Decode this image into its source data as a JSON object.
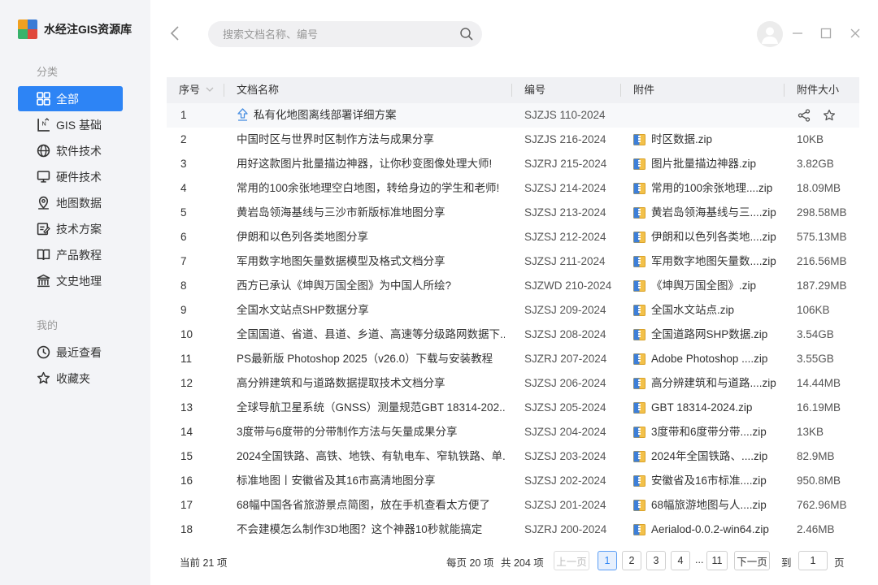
{
  "app": {
    "title": "水经注GIS资源库"
  },
  "sidebar": {
    "section_category": "分类",
    "categories": [
      {
        "label": "全部",
        "icon": "grid-icon",
        "active": true
      },
      {
        "label": "GIS 基础",
        "icon": "gis-basic-icon"
      },
      {
        "label": "软件技术",
        "icon": "globe-icon"
      },
      {
        "label": "硬件技术",
        "icon": "monitor-icon"
      },
      {
        "label": "地图数据",
        "icon": "map-pin-icon"
      },
      {
        "label": "技术方案",
        "icon": "edit-doc-icon"
      },
      {
        "label": "产品教程",
        "icon": "book-icon"
      },
      {
        "label": "文史地理",
        "icon": "temple-icon"
      }
    ],
    "section_mine": "我的",
    "mine": [
      {
        "label": "最近查看",
        "icon": "clock-icon"
      },
      {
        "label": "收藏夹",
        "icon": "star-icon"
      }
    ]
  },
  "search": {
    "placeholder": "搜索文档名称、编号",
    "value": ""
  },
  "table": {
    "headers": {
      "index": "序号",
      "name": "文档名称",
      "code": "编号",
      "attachment": "附件",
      "size": "附件大小"
    },
    "rows": [
      {
        "index": "1",
        "name": "私有化地图离线部署详细方案",
        "code": "SJZJS 110-2024",
        "attachment": "",
        "size": ""
      },
      {
        "index": "2",
        "name": "中国时区与世界时区制作方法与成果分享",
        "code": "SJZJS 216-2024",
        "attachment": "时区数据.zip",
        "size": "10KB"
      },
      {
        "index": "3",
        "name": "用好这款图片批量描边神器，让你秒变图像处理大师!",
        "code": "SJZRJ 215-2024",
        "attachment": "图片批量描边神器.zip",
        "size": "3.82GB"
      },
      {
        "index": "4",
        "name": "常用的100余张地理空白地图，转给身边的学生和老师!",
        "code": "SJZSJ 214-2024",
        "attachment": "常用的100余张地理....zip",
        "size": "18.09MB"
      },
      {
        "index": "5",
        "name": "黄岩岛领海基线与三沙市新版标准地图分享",
        "code": "SJZSJ 213-2024",
        "attachment": "黄岩岛领海基线与三....zip",
        "size": "298.58MB"
      },
      {
        "index": "6",
        "name": "伊朗和以色列各类地图分享",
        "code": "SJZSJ 212-2024",
        "attachment": "伊朗和以色列各类地....zip",
        "size": "575.13MB"
      },
      {
        "index": "7",
        "name": "军用数字地图矢量数据模型及格式文档分享",
        "code": "SJZSJ 211-2024",
        "attachment": "军用数字地图矢量数....zip",
        "size": "216.56MB"
      },
      {
        "index": "8",
        "name": "西方已承认《坤舆万国全图》为中国人所绘?",
        "code": "SJZWD 210-2024",
        "attachment": "《坤舆万国全图》.zip",
        "size": "187.29MB"
      },
      {
        "index": "9",
        "name": "全国水文站点SHP数据分享",
        "code": "SJZSJ 209-2024",
        "attachment": "全国水文站点.zip",
        "size": "106KB"
      },
      {
        "index": "10",
        "name": "全国国道、省道、县道、乡道、高速等分级路网数据下...",
        "code": "SJZSJ 208-2024",
        "attachment": "全国道路网SHP数据.zip",
        "size": "3.54GB"
      },
      {
        "index": "11",
        "name": "PS最新版 Photoshop 2025（v26.0）下载与安装教程",
        "code": "SJZRJ 207-2024",
        "attachment": "Adobe Photoshop ....zip",
        "size": "3.55GB"
      },
      {
        "index": "12",
        "name": "高分辨建筑和与道路数据提取技术文档分享",
        "code": "SJZSJ 206-2024",
        "attachment": "高分辨建筑和与道路....zip",
        "size": "14.44MB"
      },
      {
        "index": "13",
        "name": "全球导航卫星系统（GNSS）测量规范GBT 18314-202...",
        "code": "SJZSJ 205-2024",
        "attachment": "GBT 18314-2024.zip",
        "size": "16.19MB"
      },
      {
        "index": "14",
        "name": "3度带与6度带的分带制作方法与矢量成果分享",
        "code": "SJZSJ 204-2024",
        "attachment": "3度带和6度带分带....zip",
        "size": "13KB"
      },
      {
        "index": "15",
        "name": "2024全国铁路、高铁、地铁、有轨电车、窄轨铁路、单...",
        "code": "SJZSJ 203-2024",
        "attachment": "2024年全国铁路、....zip",
        "size": "82.9MB"
      },
      {
        "index": "16",
        "name": "标准地图丨安徽省及其16市高清地图分享",
        "code": "SJZSJ 202-2024",
        "attachment": "安徽省及16市标准....zip",
        "size": "950.8MB"
      },
      {
        "index": "17",
        "name": "68幅中国各省旅游景点简图，放在手机查看太方便了",
        "code": "SJZSJ 201-2024",
        "attachment": "68幅旅游地图与人....zip",
        "size": "762.96MB"
      },
      {
        "index": "18",
        "name": "不会建模怎么制作3D地图？这个神器10秒就能搞定",
        "code": "SJZRJ 200-2024",
        "attachment": "Aerialod-0.0.2-win64.zip",
        "size": "2.46MB"
      }
    ]
  },
  "footer": {
    "current_total": "当前 21 项",
    "per_page": "每页 20 项",
    "total": "共 204 项",
    "prev": "上一页",
    "pages": [
      "1",
      "2",
      "3",
      "4"
    ],
    "current_page": "1",
    "ellipsis": "...",
    "last_page": "11",
    "next": "下一页",
    "goto_label": "到",
    "goto_value": "1",
    "page_label": "页"
  },
  "colors": {
    "accent": "#2d84f5",
    "sidebar_bg": "#f3f4f7",
    "header_bg": "#f0f1f4"
  }
}
